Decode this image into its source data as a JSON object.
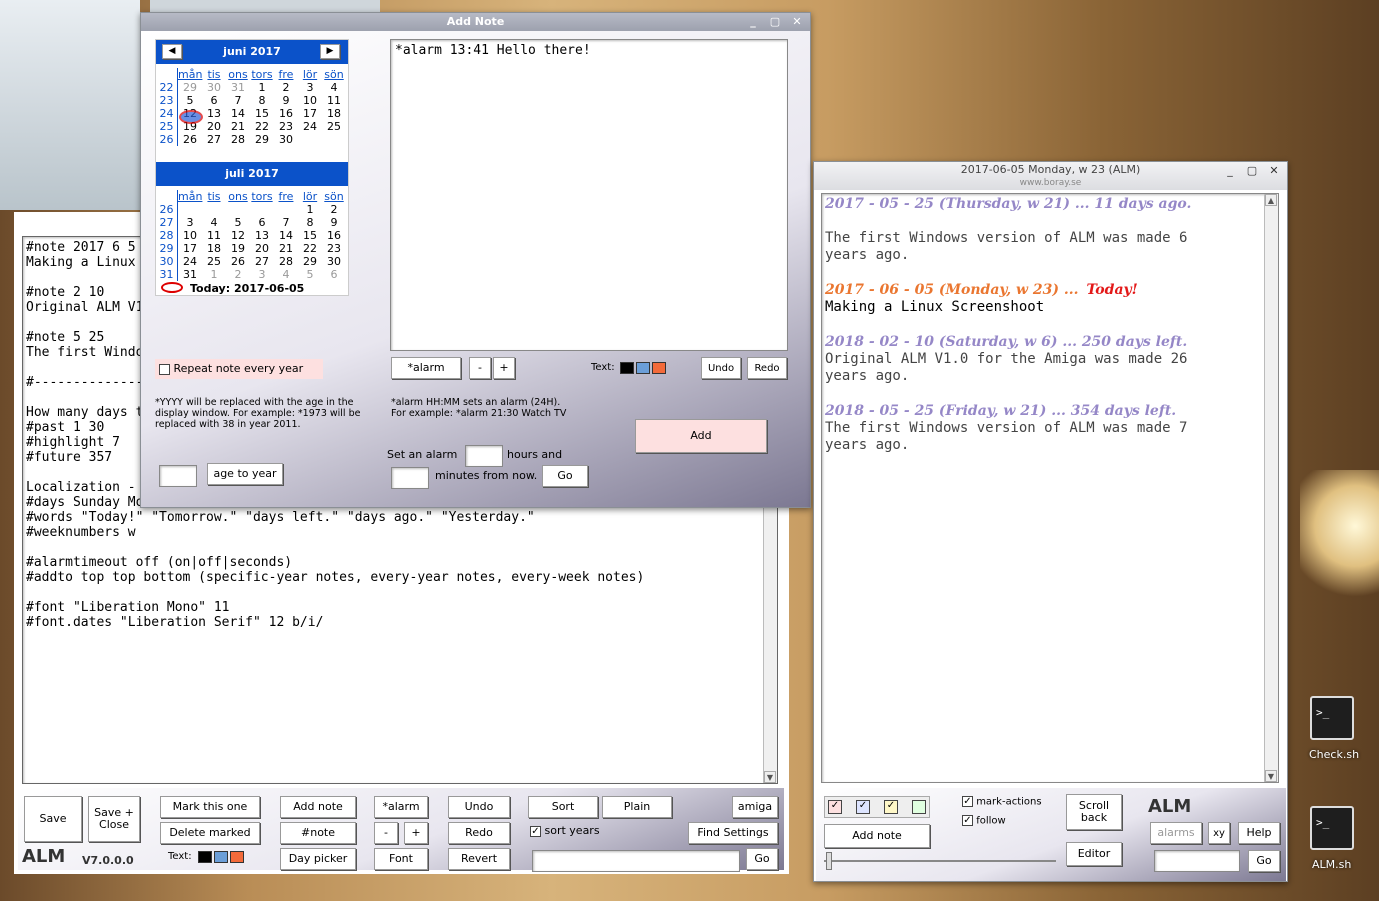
{
  "editor": {
    "text": "#note 2017 6 5\nMaking a Linux\n\n#note 2 10\nOriginal ALM V1\n\n#note 5 25\nThe first Windo\n\n#--------------\n\nHow many days t\n#past 1 30\n#highlight 7\n#future 357\n\nLocalization - \n#days Sunday Mo\n#words \"Today!\" \"Tomorrow.\" \"days left.\" \"days ago.\" \"Yesterday.\"\n#weeknumbers w\n\n#alarmtimeout off (on|off|seconds)\n#addto top top bottom (specific-year notes, every-year notes, every-week notes)\n\n#font \"Liberation Mono\" 11\n#font.dates \"Liberation Serif\" 12 b/i/",
    "buttons": {
      "save": "Save",
      "save_close": "Save +\nClose",
      "mark": "Mark this one",
      "delete": "Delete marked",
      "add_note": "Add note",
      "note": "#note",
      "day_picker": "Day picker",
      "alarm": "*alarm",
      "minus": "-",
      "plus": "+",
      "font": "Font",
      "undo": "Undo",
      "redo": "Redo",
      "revert": "Revert",
      "sort": "Sort",
      "plain": "Plain",
      "sort_years": "sort years",
      "amiga": "amiga",
      "find_settings": "Find Settings",
      "go": "Go"
    },
    "logo": "ALM",
    "version": "V7.0.0.0",
    "text_label": "Text:"
  },
  "addnote": {
    "title": "Add Note",
    "calendar1": {
      "month": "juni 2017",
      "days": [
        "mån",
        "tis",
        "ons",
        "tors",
        "fre",
        "lör",
        "sön"
      ],
      "rows": [
        [
          "22",
          "29",
          "30",
          "31",
          "1",
          "2",
          "3",
          "4"
        ],
        [
          "23",
          "5",
          "6",
          "7",
          "8",
          "9",
          "10",
          "11"
        ],
        [
          "24",
          "12",
          "13",
          "14",
          "15",
          "16",
          "17",
          "18"
        ],
        [
          "25",
          "19",
          "20",
          "21",
          "22",
          "23",
          "24",
          "25"
        ],
        [
          "26",
          "26",
          "27",
          "28",
          "29",
          "30",
          "",
          ""
        ]
      ]
    },
    "calendar2": {
      "month": "juli 2017",
      "days": [
        "mån",
        "tis",
        "ons",
        "tors",
        "fre",
        "lör",
        "sön"
      ],
      "rows": [
        [
          "26",
          "",
          "",
          "",
          "",
          "",
          "1",
          "2"
        ],
        [
          "27",
          "3",
          "4",
          "5",
          "6",
          "7",
          "8",
          "9"
        ],
        [
          "28",
          "10",
          "11",
          "12",
          "13",
          "14",
          "15",
          "16"
        ],
        [
          "29",
          "17",
          "18",
          "19",
          "20",
          "21",
          "22",
          "23"
        ],
        [
          "30",
          "24",
          "25",
          "26",
          "27",
          "28",
          "29",
          "30"
        ],
        [
          "31",
          "31",
          "1",
          "2",
          "3",
          "4",
          "5",
          "6"
        ]
      ]
    },
    "today": "Today: 2017-06-05",
    "note_text": "*alarm 13:41 Hello there!",
    "repeat": "Repeat note every year",
    "help_year": "*YYYY will be replaced with the age in the display window. For example: *1973 will be replaced with 38 in year 2011.",
    "help_alarm": "*alarm HH:MM sets an alarm (24H).\nFor example: *alarm 21:30 Watch TV",
    "age_to_year": "age to year",
    "alarm_btn": "*alarm",
    "minus": "-",
    "plus": "+",
    "text_label": "Text:",
    "undo": "Undo",
    "redo": "Redo",
    "add": "Add",
    "set_alarm": "Set an alarm",
    "hours_and": "hours and",
    "minutes": "minutes from now.",
    "go": "Go"
  },
  "display": {
    "title": "2017-06-05  Monday, w 23  (ALM)",
    "subtitle": "www.boray.se",
    "entries": [
      {
        "date": "2017 - 05 - 25   (Thursday, w 21) ... 11 days ago.",
        "text": "\nThe first Windows version of ALM was made 6\nyears ago.",
        "today": false
      },
      {
        "date": "2017 - 06 - 05   (Monday, w 23) ...",
        "today_word": "Today!",
        "text": "Making a Linux Screenshoot",
        "today": true
      },
      {
        "date": "2018 - 02 - 10   (Saturday, w 6) ... 250 days left.",
        "text": "Original ALM V1.0 for the Amiga was made 26\nyears ago.",
        "today": false
      },
      {
        "date": "2018 - 05 - 25   (Friday, w 21) ... 354 days left.",
        "text": "The first Windows version of ALM was made 7\nyears ago.",
        "today": false
      }
    ],
    "buttons": {
      "add_note": "Add note",
      "mark_actions": "mark-actions",
      "follow": "follow",
      "scroll_back": "Scroll\nback",
      "editor": "Editor",
      "alarms": "alarms",
      "xy": "xy",
      "help": "Help",
      "go": "Go"
    },
    "logo": "ALM"
  },
  "desktop": [
    {
      "label": "Check.sh"
    },
    {
      "label": "ALM.sh"
    }
  ],
  "colors": {
    "accent": "#0b52c9",
    "today": "#e00000",
    "highlight": "#e8681a",
    "date": "#8a7bc2"
  }
}
